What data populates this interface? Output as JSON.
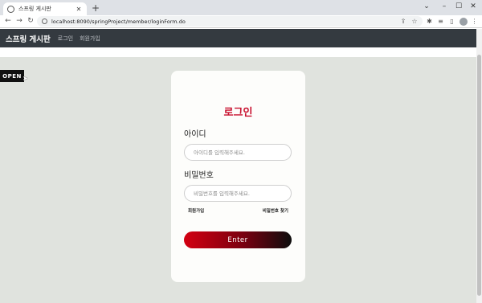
{
  "browser": {
    "tab": {
      "title": "스프링 게시판",
      "favicon_icon": "globe-icon",
      "close_icon": "close-icon"
    },
    "new_tab_icon": "plus-icon",
    "window_controls": [
      "chevron-down-icon",
      "minimize-icon",
      "maximize-icon",
      "close-icon"
    ],
    "nav_icons": [
      "back-arrow-icon",
      "forward-arrow-icon",
      "reload-icon"
    ],
    "url": "localhost:8090/springProject/member/loginForm.do",
    "omnibox_actions": [
      "share-icon",
      "bookmark-star-icon"
    ],
    "toolbar_icons": [
      "extensions-icon",
      "reading-list-icon",
      "side-panel-icon",
      "profile-icon",
      "menu-icon"
    ]
  },
  "site_nav": {
    "brand": "스프링 게시판",
    "links": [
      "로그인",
      "회원가입"
    ],
    "background_color": "#343a40"
  },
  "overlay": {
    "open_badge": "OPEN"
  },
  "login_card": {
    "title": "로그인",
    "title_color": "#c8102e",
    "id_label": "아이디",
    "id_placeholder": "아이디를 입력해주세요.",
    "id_value": "",
    "password_label": "비밀번호",
    "password_placeholder": "비밀번호를 입력해주세요.",
    "password_value": "",
    "signup_link": "회원가입",
    "find_password_link": "비밀번호 찾기",
    "submit_label": "Enter"
  }
}
